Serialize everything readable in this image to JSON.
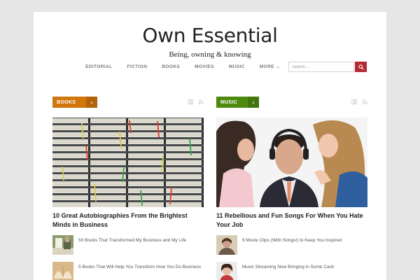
{
  "site": {
    "title": "Own Essential",
    "tagline": "Being, owning & knowing"
  },
  "nav": {
    "items": [
      "EDITORIAL",
      "FICTION",
      "BOOKS",
      "MOVIES",
      "MUSIC",
      "MORE"
    ]
  },
  "search": {
    "placeholder": "Search..."
  },
  "colors": {
    "books_badge": "#d1760b",
    "music_badge": "#4f8a10",
    "search_button": "#b52b33"
  },
  "icons": {
    "list": "list-view-icon",
    "rss": "rss-icon",
    "search": "search-icon",
    "arrow": "chevron-right-icon",
    "more": "chevron-down-icon"
  },
  "columns": [
    {
      "category": "BOOKS",
      "featured_title": "10 Great Autobiographies From the Brightest Minds in Business",
      "posts": [
        "50 Books That Transformed My Business and My Life",
        "5 Books That Will Help You Transform How You Do Business"
      ]
    },
    {
      "category": "MUSIC",
      "featured_title": "11 Rebellious and Fun Songs For When You Hate Your Job",
      "posts": [
        "9 Movie Clips (With Songs!) to Keep You Inspired",
        "Music Streaming Now Bringing in Some Cash"
      ]
    }
  ]
}
